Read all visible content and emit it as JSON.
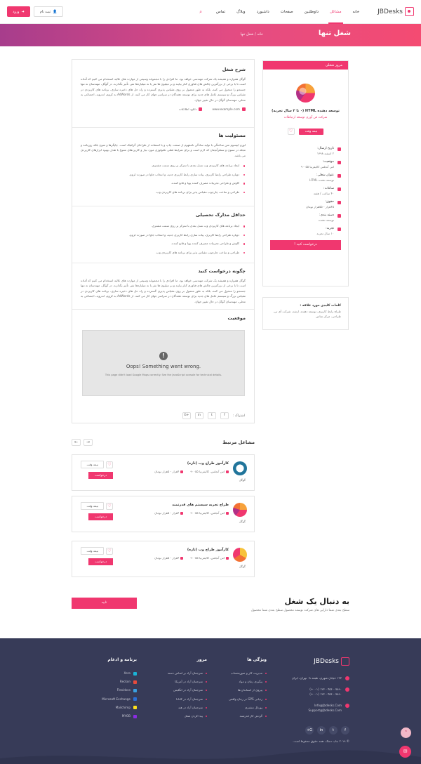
{
  "header": {
    "logo": "JBDesks",
    "nav": [
      "خانه",
      "مشاغل",
      "داوطلبین",
      "صفحات",
      "داشبورد",
      "وبلاگ",
      "تماس"
    ],
    "active_nav": 1,
    "register_label": "ثبت نام",
    "login_label": "ورود"
  },
  "banner": {
    "title": "شغل تنها",
    "breadcrumb_home": "خانه",
    "breadcrumb_sep": "/",
    "breadcrumb_current": "شغل تنها"
  },
  "main": {
    "desc_title": "شرح شغل",
    "desc_text": "گوگل همواره و همیشه یک شرکت مهندسی خواهد بود. ما افرادی را با مجموعه وسیعی از مهارت های عالیه استخدام می کنیم که آماده است تا با برخی از بزرگترین چالش های فناوری کنار بیایند و بر میلیون ها نفر یا نه میلیاردها نفر، تأثیر بگذارند. در گوگل، مهندسان نه تنها جستجو را متحول می کنند، بلکه به طور معمول بر روی مقیاس پذیری گسترده و راه حل های ذخیره سازی، برنامه های کاربردی در مقیاس بزرگ و سیستم عامل های جدید برای توسعه دهندگان در سراسر جهان کار می کنند. از AdWords به کروم، اندروید، اجتماعی به محلی، مهندسان گوگل در حال تغییر جهان.",
    "website": "www.example.com",
    "download": "دانلود اطلاعات",
    "resp_title": "مسئولیت ها",
    "resp_text": "لورم ایپسوم متن ساختگی با تولید سادگی نامفهوم از صنعت چاپ و با استفاده از طراحان گرافیک است. چاپگرها و متون بلکه روزنامه و مجله در ستون و سطرآنچنان که لازم است و برای شرایط فعلی تکنولوژی مورد نیاز و کاربردهای متنوع با هدف بهبود ابزارهای کاربردی می باشد.",
    "resp_items": [
      "ایجاد برنامه های کاربردی وب نسل بعدی با تمرکز بر روی سمت مشتری.",
      "دوباره طراحی رابط کاربری، پیاده سازی رابط کاربری جدید، و انتخاب جاوا در صورت لزوم.",
      "کاوش و طراحی تجربیات مصرف کننده پویا و قانع کننده.",
      "طراحی و ساخت چارچوب مقیاس پذیر برای برنامه های کاربردی وب."
    ],
    "edu_title": "حداقل مدارک تحصیلی",
    "edu_items": [
      "ایجاد برنامه های کاربردی وب نسل بعدی با تمرکز بر روی سمت مشتری.",
      "دوباره طراحی رابط کاربری، پیاده سازی رابط کاربری جدید، و انتخاب جاوا در صورت لزوم.",
      "کاوش و طراحی تجربیات مصرف کننده پویا و قانع کننده.",
      "طراحی و ساخت چارچوب مقیاس پذیر برای برنامه های کاربردی وب."
    ],
    "apply_title": "چگونه درخواست کنید",
    "apply_text": "گوگل همواره و همیشه یک شرکت مهندسی خواهد بود. ما افرادی را با مجموعه وسیعی از مهارت های عالیه استخدام می کنیم که آماده است تا با برخی از بزرگترین چالش های فناوری کنار بیایند و بر میلیون ها نفر یا نه میلیاردها نفر، تأثیر بگذارند. در گوگل، مهندسان نه تنها جستجو را متحول می کنند، بلکه به طور معمول بر روی مقیاس پذیری گسترده و راه حل های ذخیره سازی، برنامه های کاربردی در مقیاس بزرگ و سیستم عامل های جدید برای توسعه دهندگان در سراسر جهان کار می کنند. از AdWords به کروم، اندروید، اجتماعی به محلی، مهندسان گوگل در حال تغییر جهان.",
    "location_title": "موقعیت",
    "map_error": "Oops! Something went wrong.",
    "map_error_detail": "This page didn't load Google Maps correctly. See the JavaScript console for technical details.",
    "share_label": "اشتراک :",
    "share_icons": [
      "f",
      "t",
      "in",
      "G+"
    ]
  },
  "sidebar": {
    "header": "مرور شغلی",
    "job_title": "توسعه دهنده HTML (۰ تا ۲ سال تجربه)",
    "company": "شرکت فن آوری توسعه ارتباطات",
    "job_type": "نیمه وقت",
    "info": [
      {
        "label": "تاریخ ارسال:",
        "value": "۲ اسفند ۱۳۹۸"
      },
      {
        "label": "موقعیت:",
        "value": "اس آنجلس کالیفرنیا ۹۰۰۵۵"
      },
      {
        "label": "عنوان شغلی:",
        "value": "توسعه دهنده HTML"
      },
      {
        "label": "ساعات:",
        "value": "۴۰ ساعت / هفته"
      },
      {
        "label": "حقوق:",
        "value": "۴۵هزار - ۵۵هزار تومان"
      },
      {
        "label": "دسته بندی:",
        "value": "توسعه دهنده"
      },
      {
        "label": "تجربه:",
        "value": "۱۰ سال تجربه"
      }
    ],
    "apply_button": "درخواست کنید !",
    "keywords_title": "کلمات کلیدی مورد علاقه :",
    "keywords": "طراح رابط کاربری، توسعه دهنده، ارشد، شرکت آی تی، طراحی، مرکز تماس"
  },
  "related": {
    "title": "مشاغل مرتبط",
    "jobs": [
      {
        "title": "کارآموز طراح وب (تازه)",
        "salary": "۴هزار - ۵هزار تومان",
        "location": "اس آنجلس، کالیفرنیا ۹۰۰۵۵",
        "company": "گوگل",
        "type": "نیمه وقت",
        "apply": "درخواست"
      },
      {
        "title": "طراح تجربه سیستم های قدرتمند",
        "salary": "۴هزار - ۵هزار تومان",
        "location": "اس آنجلس، کالیفرنیا ۹۰۰۵۵",
        "company": "گوگل",
        "type": "نیمه وقت",
        "apply": "درخواست"
      },
      {
        "title": "کارآموز طراح وب (تازه)",
        "salary": "۴هزار - ۵هزار تومان",
        "location": "اس آنجلس، کالیفرنیا ۹۰۰۵۵",
        "company": "گوگل",
        "type": "نیمه وقت",
        "apply": "درخواست"
      }
    ]
  },
  "cta": {
    "title": "به دنبال یک شغل",
    "subtitle": "سطح بعدی شما دارایی های شرکت توسعه محصول سطح بعدی شما محصول",
    "button": "تایید"
  },
  "footer": {
    "logo": "JBDesks",
    "address": "۱۲۳ خیابان شهری، طبقه ۰۸ تهران، ایران",
    "phones": "۷۸۹۰ - ۴۵۶ - ۱۲۳ (۰۰۱+)",
    "phones2": "۷۸۹۰ - ۴۵۶ - ۱۲۳ (۰۰۱+)",
    "emails": "Info@Jbdesks.Com",
    "emails2": "Support@Jbdesks.Com",
    "features_title": "ویژگی ها",
    "features": [
      "مدیریت کار و صورتحساب",
      "پیگیری زمان و مواد",
      "پیروی از استانداردها",
      "ردیابی GPS در زمان واقعی",
      "پورتال مشتری",
      "گردش کار قدرتمند"
    ],
    "browse_title": "مرور",
    "browse": [
      "مترجمان آزاد بر اساس دسته",
      "مترجمان آزاد در آمریکا",
      "مترجمان آزاد در انگلیس",
      "مترجمان آزاد در کانادا",
      "مترجمان آزاد در هند",
      "پیدا کردن شغل"
    ],
    "apps_title": "برنامه و ادغام",
    "apps": [
      "Xero",
      "Reckon",
      "Flexidocs",
      "Microsoft Exchange",
      "Mailchimp",
      "MYOB"
    ],
    "copyright": "© ۲۰۱۹ جاب دسک. همه حقوق محفوظ است."
  },
  "colors": {
    "accent": "#f0376f",
    "footer_bg": "#373b58"
  }
}
